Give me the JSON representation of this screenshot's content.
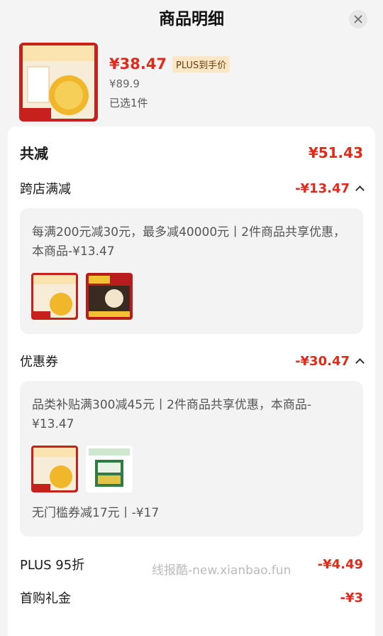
{
  "header": {
    "title": "商品明细",
    "close_icon": "close-icon"
  },
  "product": {
    "price": "¥38.47",
    "plus_tag": "PLUS到手价",
    "original_price": "¥89.9",
    "selected_count": "已选1件",
    "image_text_top": "双桃润颜 送礼佳品",
    "image_price_tag": "89.9"
  },
  "summary": {
    "total_label": "共减",
    "total_value": "¥51.43",
    "cross_store": {
      "label": "跨店满减",
      "value": "-¥13.47",
      "detail": "每满200元减30元，最多减40000元丨2件商品共享优惠，本商品-¥13.47"
    },
    "coupon": {
      "label": "优惠券",
      "value": "-¥30.47",
      "detail": "品类补贴满300减45元丨2件商品共享优惠，本商品-¥13.47",
      "extra": "无门槛券减17元丨-¥17"
    },
    "plus_discount": {
      "label": "PLUS 95折",
      "value": "-¥4.49"
    },
    "first_gift": {
      "label": "首购礼金",
      "value": "-¥3"
    }
  },
  "watermark": "线报酷-new.xianbao.fun",
  "colors": {
    "accent_red": "#e22a1a",
    "plus_gold": "#fbe7c6",
    "panel_bg": "#f3f3f3"
  }
}
